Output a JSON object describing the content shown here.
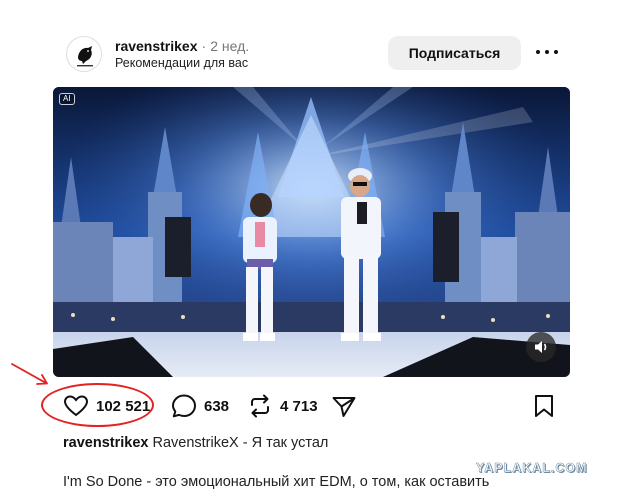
{
  "post": {
    "username": "ravenstrikex",
    "separator": "·",
    "time": "2 нед.",
    "subtitle": "Рекомендации для вас",
    "follow_label": "Подписаться",
    "more_icon": "more-horizontal-icon",
    "avatar_icon": "raven-logo-icon"
  },
  "media": {
    "ai_badge": "AI",
    "mute_icon": "speaker-icon"
  },
  "actions": {
    "likes": "102 521",
    "comments": "638",
    "reposts": "4 713",
    "like_icon": "heart-icon",
    "comment_icon": "comment-bubble-icon",
    "repost_icon": "repost-arrows-icon",
    "share_icon": "send-icon",
    "save_icon": "bookmark-icon"
  },
  "caption": {
    "username": "ravenstrikex",
    "text": "RavenstrikeX - Я так устал"
  },
  "description": {
    "line1": "I'm So Done - это эмоциональный хит EDM, о том, как оставить"
  },
  "watermark": "YAPLAKAL.COM",
  "colors": {
    "annotation_red": "#e32222",
    "follow_bg": "#efefef",
    "stage_blue": "#1f4c9e"
  }
}
